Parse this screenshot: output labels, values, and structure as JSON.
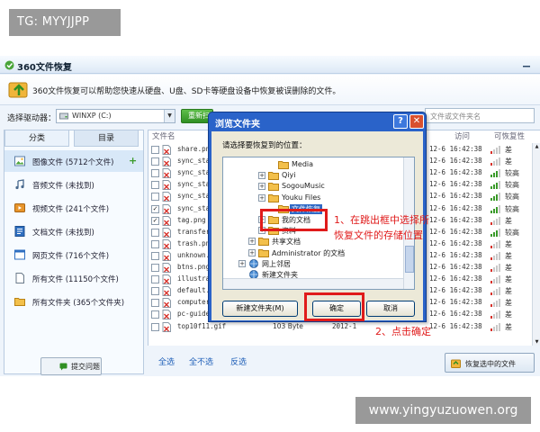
{
  "overlay": {
    "tag": "TG: MYYJJPP",
    "watermark": "www.yingyuzuowen.org"
  },
  "app": {
    "title": "360文件恢复",
    "info": "360文件恢复可以帮助您快速从硬盘、U盘、SD卡等硬盘设备中恢复被误删除的文件。",
    "drive_label": "选择驱动器：",
    "drive_value": "WINXP (C:)",
    "rescan_label": "重新扫描",
    "search_placeholder": "文件或文件夹名"
  },
  "sidebar": {
    "tabs": [
      "分类",
      "目录"
    ],
    "categories": [
      {
        "label": "图像文件 (5712个文件)",
        "icon": "image-file-icon",
        "add": "+"
      },
      {
        "label": "音频文件 (未找到)",
        "icon": "audio-file-icon"
      },
      {
        "label": "视频文件 (241个文件)",
        "icon": "video-file-icon"
      },
      {
        "label": "文档文件 (未找到)",
        "icon": "document-file-icon"
      },
      {
        "label": "网页文件 (716个文件)",
        "icon": "web-file-icon"
      },
      {
        "label": "所有文件 (11150个文件)",
        "icon": "all-files-icon"
      },
      {
        "label": "所有文件夹 (365个文件夹)",
        "icon": "all-folders-icon"
      }
    ],
    "submit_label": "提交问题"
  },
  "filelist": {
    "headers": {
      "name": "文件名",
      "access": "访问",
      "recoverability": "可恢复性"
    },
    "rows": [
      {
        "name": "share.pn",
        "checked": false,
        "date": "12-6 16:42:38",
        "status": "差"
      },
      {
        "name": "sync_sta",
        "checked": false,
        "date": "12-6 16:42:38",
        "status": "差"
      },
      {
        "name": "sync_sta",
        "checked": false,
        "date": "12-6 16:42:38",
        "status": "较高"
      },
      {
        "name": "sync_sta",
        "checked": false,
        "date": "12-6 16:42:38",
        "status": "较高"
      },
      {
        "name": "sync_sta",
        "checked": false,
        "date": "12-6 16:42:38",
        "status": "较高"
      },
      {
        "name": "sync_sta",
        "checked": true,
        "date": "12-6 16:42:38",
        "status": "较高"
      },
      {
        "name": "tag.png",
        "checked": true,
        "date": "12-6 16:42:38",
        "status": "差"
      },
      {
        "name": "transfer",
        "checked": false,
        "date": "12-6 16:42:38",
        "status": "较高"
      },
      {
        "name": "trash.pn",
        "checked": false,
        "date": "12-6 16:42:38",
        "status": "差"
      },
      {
        "name": "unknown.",
        "checked": false,
        "date": "12-6 16:42:38",
        "status": "差"
      },
      {
        "name": "btns.png",
        "checked": false,
        "date": "12-6 16:42:38",
        "status": "差"
      },
      {
        "name": "illustra",
        "checked": false,
        "date": "12-6 16:42:38",
        "status": "差"
      },
      {
        "name": "default.",
        "checked": false,
        "date": "12-6 16:42:38",
        "status": "差"
      },
      {
        "name": "computer",
        "checked": false,
        "date": "12-6 16:42:38",
        "status": "差"
      },
      {
        "name": "pc-guide-popup-bg.",
        "checked": false,
        "size": "1.69 KB",
        "date_full": "2012-1",
        "date": "12-6 16:42:38",
        "status": "差"
      },
      {
        "name": "top10f11.gif",
        "checked": false,
        "size": "103 Byte",
        "date_full": "2012-1",
        "date": "12-6 16:42:38",
        "status": "差"
      }
    ]
  },
  "bottom": {
    "select_all": "全选",
    "select_none": "全不选",
    "invert": "反选",
    "recover_label": "恢复选中的文件"
  },
  "dialog": {
    "title": "浏览文件夹",
    "prompt": "请选择要恢复到的位置：",
    "tree": [
      {
        "label": "Media",
        "indent": 2,
        "exp": ""
      },
      {
        "label": "Qiyi",
        "indent": 1,
        "exp": "+"
      },
      {
        "label": "SogouMusic",
        "indent": 1,
        "exp": "+"
      },
      {
        "label": "Youku Files",
        "indent": 1,
        "exp": "+"
      },
      {
        "label": "文件恢复",
        "indent": 2,
        "exp": "",
        "selected": true
      },
      {
        "label": "我的文档",
        "indent": 1,
        "exp": "+"
      },
      {
        "label": "资料",
        "indent": 1,
        "exp": "+"
      },
      {
        "label": "共享文档",
        "indent": 0,
        "exp": "+"
      },
      {
        "label": "Administrator 的文档",
        "indent": 0,
        "exp": "+"
      },
      {
        "label": "网上邻居",
        "indent": -1,
        "exp": "+"
      },
      {
        "label": "新建文件夹",
        "indent": -1,
        "exp": ""
      }
    ],
    "new_folder_label": "新建文件夹(M)",
    "ok_label": "确定",
    "cancel_label": "取消"
  },
  "annotations": {
    "step1_line1": "1、在跳出框中选择所",
    "step1_line2": "恢复文件的存储位置",
    "step2": "2、点击确定"
  },
  "colors": {
    "accent_red": "#e01b1b",
    "xp_blue": "#2a63c9",
    "selection_blue": "#316ac5",
    "rescan_green": "#2f8f22"
  }
}
